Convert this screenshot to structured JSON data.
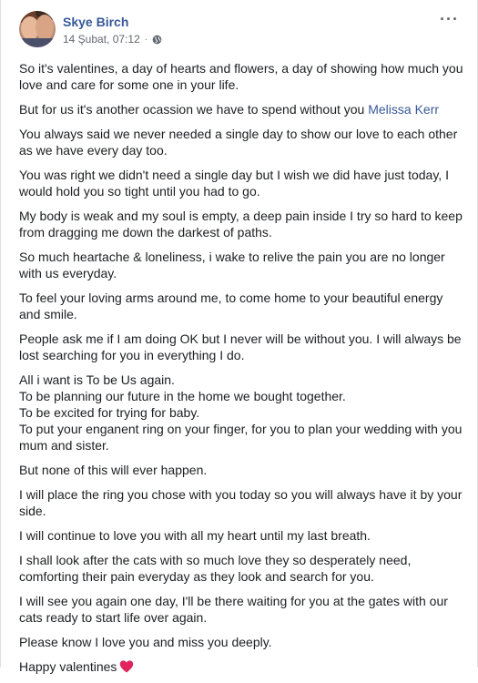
{
  "post": {
    "author": "Skye Birch",
    "timestamp": "14 Şubat, 07:12",
    "separator": "·",
    "more_label": "···",
    "privacy_icon": "globe-icon",
    "paragraphs": [
      "So it's valentines, a day of hearts and flowers, a day of showing how much you love and care for some one in your life.",
      "You always said we never needed a single day to show our love to each other as we have every day too.",
      "You was right we didn't need a single day but I wish we did have just today, I would hold you so tight until you had to go.",
      "My body is weak and my soul is empty, a deep pain inside I try so hard to keep from dragging me down the darkest of paths.",
      "So much heartache & loneliness, i wake to relive the pain you are no longer with us everyday.",
      "To feel your loving arms around me, to come home to your beautiful energy and smile.",
      "People ask me if I am doing OK but I never will be without you. I will always be lost searching for you in everything I do.",
      "But none of this will ever happen.",
      "I will place the ring you chose with you today so you will always have it by your side.",
      "I will continue to love you with all my heart until my last breath.",
      "I shall look after the cats with so much love they so desperately need, comforting their pain everyday as they look and search for you.",
      "I will see you again one day, I'll be there waiting for you at the gates with our cats ready to start life over again.",
      "Please know I love you and miss you deeply.",
      "Happy valentines"
    ],
    "tagged_line": {
      "text": "But for us it's another ocassion we have to spend without you ",
      "mention": "Melissa Kerr"
    },
    "list_lines": [
      "All i want is To be Us again.",
      "To be planning our future in the home we bought together.",
      "To be excited for trying for baby.",
      "To put your enganent ring on your finger, for you to plan your wedding with you mum and sister."
    ],
    "closing_emoji": "heart-icon",
    "colors": {
      "author": "#385898",
      "mention": "#385898",
      "meta": "#616770",
      "heart": "#e0245e"
    }
  }
}
